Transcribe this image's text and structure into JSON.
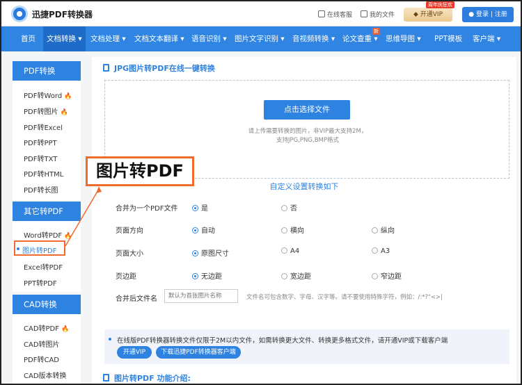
{
  "header": {
    "logo_text": "迅捷PDF转换器",
    "service_label": "在线客服",
    "files_label": "我的文件",
    "vip_tag": "周年庆狂欢",
    "vip_button": "开通VIP",
    "login_label": "登录 | 注册"
  },
  "nav": {
    "items": [
      "首页",
      "文档转换 ▾",
      "文档处理 ▾",
      "文档文本翻译 ▾",
      "语音识别 ▾",
      "图片文字识别 ▾",
      "音视频转换 ▾",
      "论文查重 ▾",
      "思维导图 ▾",
      "PPT模板",
      "客户端 ▾"
    ],
    "new_badge": "新"
  },
  "sidebar": {
    "groups": [
      {
        "title": "PDF转换",
        "items": [
          "PDF转Word",
          "PDF转图片",
          "PDF转Excel",
          "PDF转PPT",
          "PDF转TXT",
          "PDF转HTML",
          "PDF转长图"
        ]
      },
      {
        "title": "其它转PDF",
        "items": [
          "Word转PDF",
          "图片转PDF",
          "Excel转PDF",
          "PPT转PDF"
        ]
      },
      {
        "title": "CAD转换",
        "items": [
          "CAD转PDF",
          "CAD转图片",
          "PDF转CAD",
          "CAD版本转换"
        ]
      }
    ],
    "hot_icon": "fire-icon"
  },
  "callout": "图片转PDF",
  "main": {
    "title": "JPG图片转PDF在线一键转换",
    "pick_button": "点击选择文件",
    "hint1": "请上传需要转换的图片，非VIP最大支持2M，",
    "hint2": "支持JPG,PNG,BMP格式",
    "settings_title": "自定义设置转换如下",
    "rows": [
      {
        "label": "合并为一个PDF文件",
        "options": [
          "是",
          "否"
        ]
      },
      {
        "label": "页面方向",
        "options": [
          "自动",
          "横向",
          "纵向"
        ]
      },
      {
        "label": "页面大小",
        "options": [
          "原图尺寸",
          "A4",
          "A3"
        ]
      },
      {
        "label": "页边距",
        "options": [
          "无边距",
          "宽边距",
          "窄边距"
        ]
      }
    ],
    "filename_label": "合并后文件名",
    "filename_placeholder": "默认为首张图片名称",
    "filename_note": "文件名可包含数字、字母、汉字等。请不要使用特殊字符，例如：/:*?\"<>|",
    "notice": "在线版PDF转换器转换文件仅限于2M以内文件，如需转换更大文件、转换更多格式文件，请开通VIP或下载客户端",
    "btn_vip": "开通VIP",
    "btn_download": "下载迅捷PDF转换器客户端",
    "intro_title": "图片转PDF 功能介绍:"
  }
}
